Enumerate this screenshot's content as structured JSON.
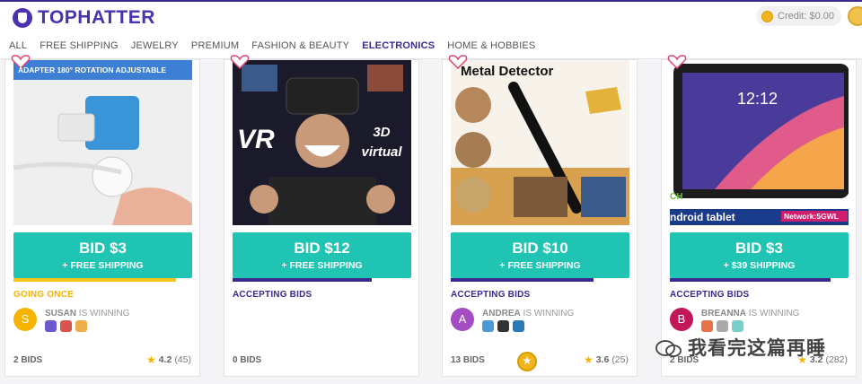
{
  "header": {
    "logo_text": "TOPHATTER",
    "credit_label": "Credit: $0.00"
  },
  "nav": {
    "items": [
      "ALL",
      "FREE SHIPPING",
      "JEWELRY",
      "PREMIUM",
      "FASHION & BEAUTY",
      "ELECTRONICS",
      "HOME & HOBBIES"
    ],
    "active": "ELECTRONICS"
  },
  "cards": [
    {
      "image_caption": "ADAPTER 180° ROTATION ADJUSTABLE",
      "bid": "BID $3",
      "shipping": "+ FREE SHIPPING",
      "status": "GOING ONCE",
      "status_color": "#f5b400",
      "progress": 0.91,
      "progress_color": "#f5c518",
      "winner_initial": "S",
      "winner_name": "SUSAN",
      "winner_suffix": " IS WINNING",
      "avatar_color": "#f5b400",
      "bids": "2 BIDS",
      "rating": "4.2",
      "reviews": "(45)"
    },
    {
      "image_caption_left": "VR",
      "image_caption_right": "3D virtual",
      "bid": "BID $12",
      "shipping": "+ FREE SHIPPING",
      "status": "ACCEPTING BIDS",
      "status_color": "#3b2a8f",
      "progress": 0.78,
      "progress_color": "#3b2a8f",
      "bids": "0 BIDS"
    },
    {
      "image_caption": "Metal Detector",
      "bid": "BID $10",
      "shipping": "+ FREE SHIPPING",
      "status": "ACCEPTING BIDS",
      "status_color": "#3b2a8f",
      "progress": 0.8,
      "progress_color": "#3b2a8f",
      "winner_initial": "A",
      "winner_name": "ANDREA",
      "winner_suffix": " IS WINNING",
      "avatar_color": "#a44cc1",
      "bids": "13 BIDS",
      "rating": "3.6",
      "reviews": "(25)"
    },
    {
      "image_caption_time": "12:12",
      "image_caption_bottom": "ndroid tablet",
      "image_caption_net": "Network:5GWL",
      "image_caption_ch": "CH",
      "bid": "BID $3",
      "shipping": "+ $39 SHIPPING",
      "status": "ACCEPTING BIDS",
      "status_color": "#3b2a8f",
      "progress": 0.9,
      "progress_color": "#3b2a8f",
      "winner_initial": "B",
      "winner_name": "BREANNA",
      "winner_suffix": " IS WINNING",
      "avatar_color": "#c2185b",
      "bids": "2 BIDS",
      "rating": "3.2",
      "reviews": "(282)"
    }
  ],
  "watermark": "我看完这篇再睡",
  "icons": {
    "logo": "tophat-icon",
    "credit": "coin-icon",
    "favorite": "heart-icon",
    "rating": "star-icon"
  }
}
